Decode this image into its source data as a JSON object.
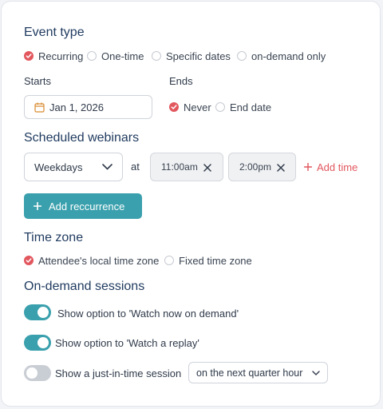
{
  "event_type": {
    "heading": "Event type",
    "options": [
      "Recurring",
      "One-time",
      "Specific dates",
      "on-demand only"
    ],
    "selected": "Recurring"
  },
  "starts": {
    "label": "Starts",
    "date_value": "Jan 1, 2026"
  },
  "ends": {
    "label": "Ends",
    "options": [
      "Never",
      "End date"
    ],
    "selected": "Never"
  },
  "scheduled": {
    "heading": "Scheduled webinars",
    "frequency_value": "Weekdays",
    "at_label": "at",
    "times": [
      "11:00am",
      "2:00pm"
    ],
    "add_time_label": "Add time",
    "add_recurrence_label": "Add reccurrence"
  },
  "time_zone": {
    "heading": "Time zone",
    "options": [
      "Attendee's local time zone",
      "Fixed time zone"
    ],
    "selected": "Attendee's local time zone"
  },
  "on_demand": {
    "heading": "On-demand sessions",
    "toggles": [
      {
        "label": "Show option to 'Watch now on demand'",
        "on": true
      },
      {
        "label": "Show option to 'Watch a replay'",
        "on": true
      },
      {
        "label": "Show a just-in-time session",
        "on": false
      }
    ],
    "jit_select_value": "on the next quarter hour"
  },
  "colors": {
    "accent_teal": "#3aa0ad",
    "accent_red": "#e2575e",
    "heading_navy": "#1f3a5f"
  }
}
